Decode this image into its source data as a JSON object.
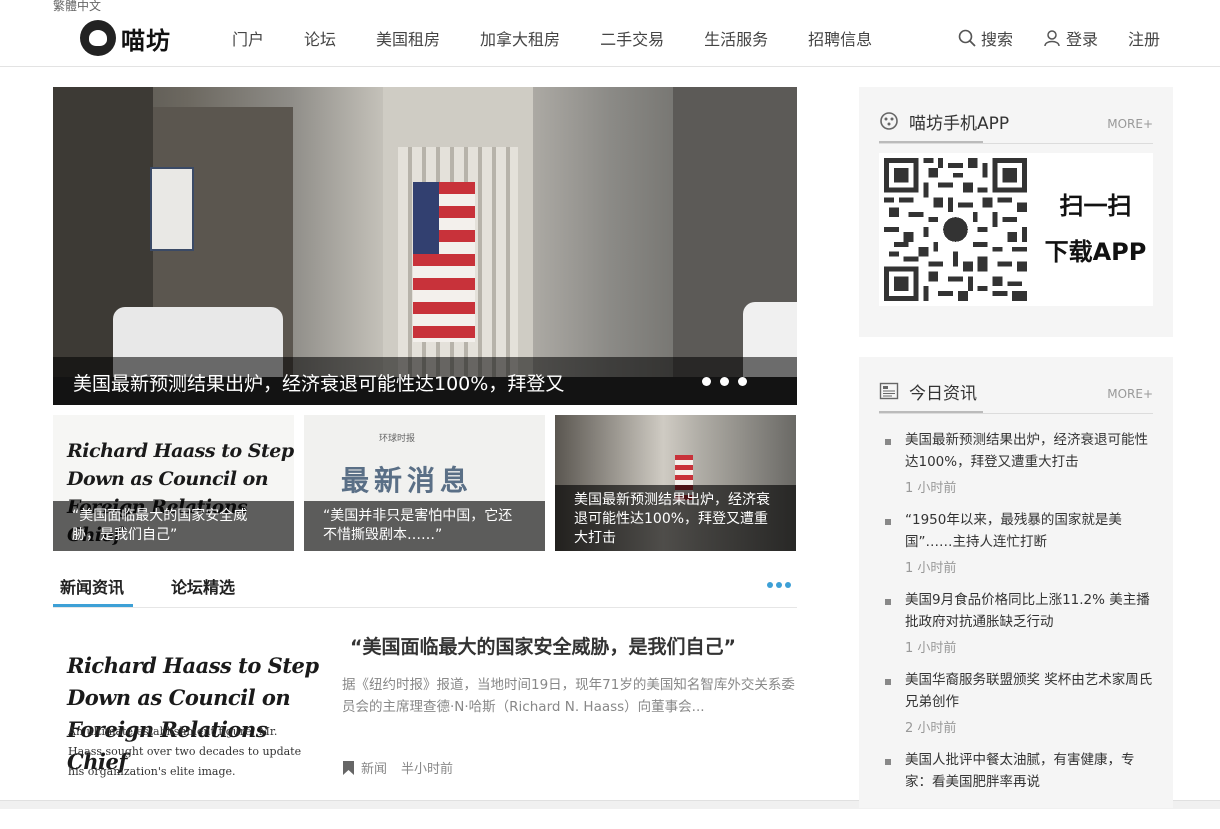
{
  "header": {
    "language_link": "繁體中文",
    "logo_text": "喵坊",
    "nav": [
      "门户",
      "论坛",
      "美国租房",
      "加拿大租房",
      "二手交易",
      "生活服务",
      "招聘信息"
    ],
    "search_label": "搜索",
    "login_label": "登录",
    "register_label": "注册"
  },
  "hero": {
    "caption": "美国最新预测结果出炉，经济衰退可能性达100%，拜登又",
    "slide_count": 3
  },
  "thumbnails": [
    {
      "image_text": "Richard Haass to Step Down as Council on Foreign Relations Chief",
      "caption": "“美国面临最大的国家安全威胁，是我们自己”"
    },
    {
      "image_publisher": "环球时报",
      "image_text": "最新消息",
      "caption": "“美国并非只是害怕中国，它还不惜撕毁剧本……”"
    },
    {
      "caption": "美国最新预测结果出炉，经济衰退可能性达100%，拜登又遭重大打击"
    }
  ],
  "tabs": [
    "新闻资讯",
    "论坛精选"
  ],
  "article": {
    "image_headline": "Richard Haass to Step Down as Council on Foreign Relations Chief",
    "image_subhead": "An ultimate establishment figure, Mr. Haass sought over two decades to update his organization's elite image.",
    "title": "“美国面临最大的国家安全威胁，是我们自己”",
    "summary": "据《纽约时报》报道，当地时间19日，现年71岁的美国知名智库外交关系委员会的主席理查德·N·哈斯（Richard N. Haass）向董事会...",
    "category": "新闻",
    "time": "半小时前"
  },
  "app_panel": {
    "title": "喵坊手机APP",
    "more": "MORE+",
    "scan_line1": "扫一扫",
    "scan_line2": "下载APP"
  },
  "news_panel": {
    "title": "今日资讯",
    "more": "MORE+",
    "items": [
      {
        "title": "美国最新预测结果出炉，经济衰退可能性达100%，拜登又遭重大打击",
        "time": "1 小时前"
      },
      {
        "title": "“1950年以来，最残暴的国家就是美国”……主持人连忙打断",
        "time": "1 小时前"
      },
      {
        "title": "美国9月食品价格同比上涨11.2% 美主播批政府对抗通胀缺乏行动",
        "time": "1 小时前"
      },
      {
        "title": "美国华裔服务联盟颁奖 奖杯由艺术家周氏兄弟创作",
        "time": "2 小时前"
      },
      {
        "title": "美国人批评中餐太油腻，有害健康，专家：看美国肥胖率再说",
        "time": ""
      }
    ]
  }
}
